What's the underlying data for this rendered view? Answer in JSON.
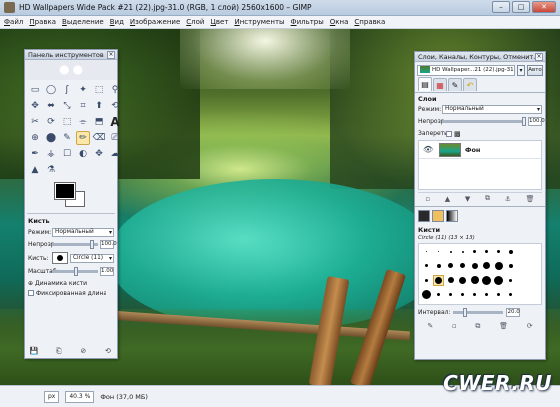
{
  "window": {
    "title": "HD Wallpapers Wide Pack #21 (22).jpg-31.0 (RGB, 1 слой) 2560x1600 – GIMP",
    "minimize": "–",
    "maximize": "□",
    "close": "✕"
  },
  "menu": [
    "Файл",
    "Правка",
    "Выделение",
    "Вид",
    "Изображение",
    "Слой",
    "Цвет",
    "Инструменты",
    "Фильтры",
    "Окна",
    "Справка"
  ],
  "toolbox": {
    "title": "Панель инструментов",
    "tools": [
      "▭",
      "◯",
      "ʃ",
      "✦",
      "⬚",
      "⚲",
      "✥",
      "⬌",
      "⤡",
      "⌗",
      "⬆",
      "⟲",
      "✂",
      "⟳",
      "⬚",
      "⌯",
      "⬒",
      "A",
      "⊕",
      "⬤",
      "✎",
      "✏",
      "⌫",
      "⎚",
      "✒",
      "⚶",
      "☐",
      "◐",
      "✥",
      "☁",
      "▲",
      "⚗"
    ],
    "tool_options": {
      "header": "Кисть",
      "mode_label": "Режим:",
      "mode_value": "Нормальный",
      "opacity_label": "Непрозр.",
      "opacity_value": "100.0",
      "brush_label": "Кисть:",
      "brush_value": "Circle (11)",
      "scale_label": "Масштаб:",
      "scale_value": "1.00",
      "dynamics_label": "Динамика кисти",
      "fade_label": "Фиксированная длина шт"
    }
  },
  "dock": {
    "title": "Слои, Каналы, Контуры, Отменит...",
    "image_combo": "HD Wallpaper...21 (22).jpg-31",
    "auto_label": "Авто",
    "layers": {
      "header": "Слои",
      "mode_label": "Режим:",
      "mode_value": "Нормальный",
      "opacity_label": "Непрозр.",
      "opacity_value": "100.0",
      "lock_label": "Запереть:",
      "layer_name": "Фон"
    },
    "brushes": {
      "header": "Кисти",
      "selected": "Circle (11) (13 × 13)",
      "interval_label": "Интервал:",
      "interval_value": "20.0"
    }
  },
  "status": {
    "unit": "px",
    "zoom": "40.3 %",
    "info": "Фон (37,0 МБ)"
  },
  "watermark": "CWER.RU"
}
